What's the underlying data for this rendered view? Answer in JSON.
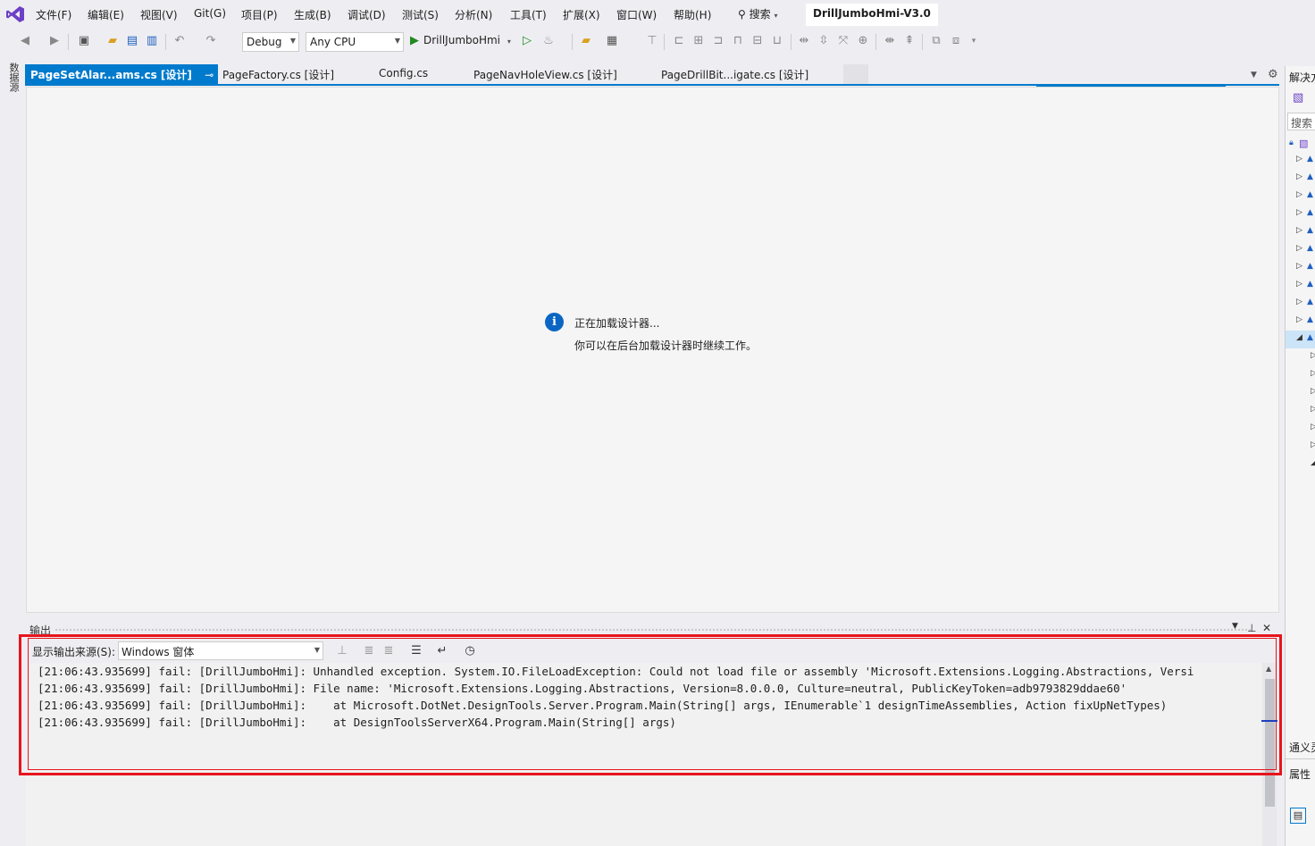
{
  "menu": {
    "items": [
      "文件(F)",
      "编辑(E)",
      "视图(V)",
      "Git(G)",
      "项目(P)",
      "生成(B)",
      "调试(D)",
      "测试(S)",
      "分析(N)",
      "工具(T)",
      "扩展(X)",
      "窗口(W)",
      "帮助(H)"
    ],
    "search_label": "搜索",
    "solution_name": "DrillJumboHmi-V3.0"
  },
  "toolbar": {
    "config": "Debug",
    "platform": "Any CPU",
    "run_target": "DrillJumboHmi"
  },
  "left_strip": {
    "tab_label": "数据源"
  },
  "tabs": [
    {
      "label": "PageSetAlar...ams.cs [设计]",
      "active": true
    },
    {
      "label": "PageFactory.cs [设计]",
      "active": false
    },
    {
      "label": "Config.cs",
      "active": false
    },
    {
      "label": "PageNavHoleView.cs [设计]",
      "active": false
    },
    {
      "label": "PageDrillBit...igate.cs [设计]",
      "active": false
    }
  ],
  "designer": {
    "loading_title": "正在加载设计器...",
    "loading_subtitle": "你可以在后台加载设计器时继续工作。"
  },
  "output": {
    "title": "输出",
    "source_label": "显示输出来源(S):",
    "source_value": "Windows 窗体",
    "lines": [
      "[21:06:43.935699] fail: [DrillJumboHmi]: Unhandled exception. System.IO.FileLoadException: Could not load file or assembly 'Microsoft.Extensions.Logging.Abstractions, Versi",
      "[21:06:43.935699] fail: [DrillJumboHmi]: File name: 'Microsoft.Extensions.Logging.Abstractions, Version=8.0.0.0, Culture=neutral, PublicKeyToken=adb9793829ddae60'",
      "[21:06:43.935699] fail: [DrillJumboHmi]:    at Microsoft.DotNet.DesignTools.Server.Program.Main(String[] args, IEnumerable`1 designTimeAssemblies, Action fixUpNetTypes)",
      "[21:06:43.935699] fail: [DrillJumboHmi]:    at DesignToolsServerX64.Program.Main(String[] args)"
    ]
  },
  "right_panel": {
    "title": "解决方",
    "search_placeholder": "搜索",
    "bottom_tab": "通义灵",
    "properties_title": "属性"
  },
  "colors": {
    "accent": "#007acc",
    "highlight": "#e8141c",
    "info": "#0a66c2",
    "run": "#1f8a1f"
  }
}
